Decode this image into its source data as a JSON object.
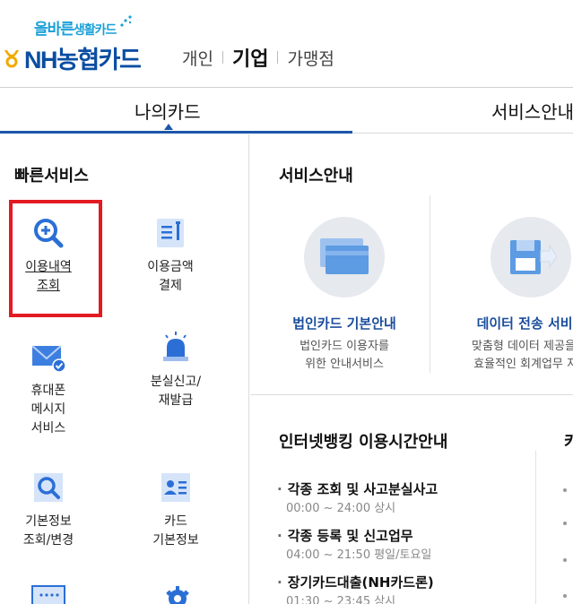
{
  "header": {
    "slogan_main": "올바른",
    "slogan_sub": "생활카드",
    "logo_text": "NH농협카드",
    "nav": [
      {
        "label": "개인",
        "active": false
      },
      {
        "label": "기업",
        "active": true
      },
      {
        "label": "가맹점",
        "active": false
      }
    ]
  },
  "tabs": [
    {
      "label": "나의카드",
      "active": true
    },
    {
      "label": "서비스안내",
      "active": false
    }
  ],
  "quick": {
    "title": "빠른서비스",
    "items": [
      {
        "line1": "이용내역",
        "line2": "조회",
        "line3": "",
        "icon": "search-plus-icon"
      },
      {
        "line1": "이용금액",
        "line2": "결제",
        "line3": "",
        "icon": "bill-icon"
      },
      {
        "line1": "휴대폰",
        "line2": "메시지",
        "line3": "서비스",
        "icon": "mail-icon"
      },
      {
        "line1": "분실신고/",
        "line2": "재발급",
        "line3": "",
        "icon": "siren-icon"
      },
      {
        "line1": "기본정보",
        "line2": "조회/변경",
        "line3": "",
        "icon": "search-doc-icon"
      },
      {
        "line1": "카드",
        "line2": "기본정보",
        "line3": "",
        "icon": "id-card-icon"
      }
    ]
  },
  "service": {
    "title": "서비스안내",
    "cards": [
      {
        "name": "법인카드 기본안내",
        "desc1": "법인카드 이용자를",
        "desc2": "위한 안내서비스",
        "icon": "cards-icon"
      },
      {
        "name": "데이터 전송 서비스",
        "desc1": "맞춤형 데이터 제공을 통",
        "desc2": "효율적인 회계업무 지원",
        "icon": "floppy-transfer-icon"
      }
    ]
  },
  "banking": {
    "title": "인터넷뱅킹 이용시간안내",
    "title2": "카",
    "items": [
      {
        "head": "각종 조회 및 사고분실사고",
        "time": "00:00 ~ 24:00 상시"
      },
      {
        "head": "각종 등록 및 신고업무",
        "time": "04:00 ~ 21:50 평일/토요일"
      },
      {
        "head": "장기카드대출(NH카드론)",
        "time": "01:30 ~ 23:45 상시"
      }
    ]
  },
  "colors": {
    "brand_blue": "#1b57a8",
    "highlight_red": "#e21a22",
    "icon_blue": "#2b6fd6"
  }
}
